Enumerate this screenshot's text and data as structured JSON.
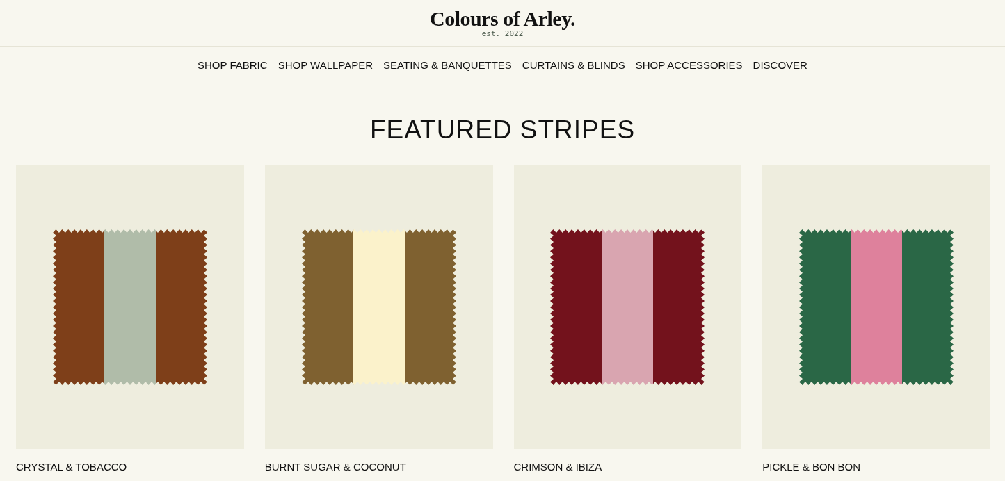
{
  "logo": {
    "name": "Colours of Arley.",
    "tagline": "est. 2022"
  },
  "nav": [
    "SHOP FABRIC",
    "SHOP WALLPAPER",
    "SEATING & BANQUETTES",
    "CURTAINS & BLINDS",
    "SHOP ACCESSORIES",
    "DISCOVER"
  ],
  "heading": "FEATURED STRIPES",
  "products": [
    {
      "name": "CRYSTAL & TOBACCO",
      "stripes": [
        {
          "color": "#7e3f19"
        },
        {
          "color": "#b0bca9"
        },
        {
          "color": "#7e3f19"
        }
      ]
    },
    {
      "name": "BURNT SUGAR & COCONUT",
      "stripes": [
        {
          "color": "#7f6130"
        },
        {
          "color": "#fbf2cb"
        },
        {
          "color": "#7f6130"
        }
      ]
    },
    {
      "name": "CRIMSON & IBIZA",
      "stripes": [
        {
          "color": "#73121c"
        },
        {
          "color": "#d9a5b0"
        },
        {
          "color": "#73121c"
        }
      ]
    },
    {
      "name": "PICKLE & BON BON",
      "stripes": [
        {
          "color": "#2a6746"
        },
        {
          "color": "#de819c"
        },
        {
          "color": "#2a6746"
        }
      ]
    }
  ]
}
